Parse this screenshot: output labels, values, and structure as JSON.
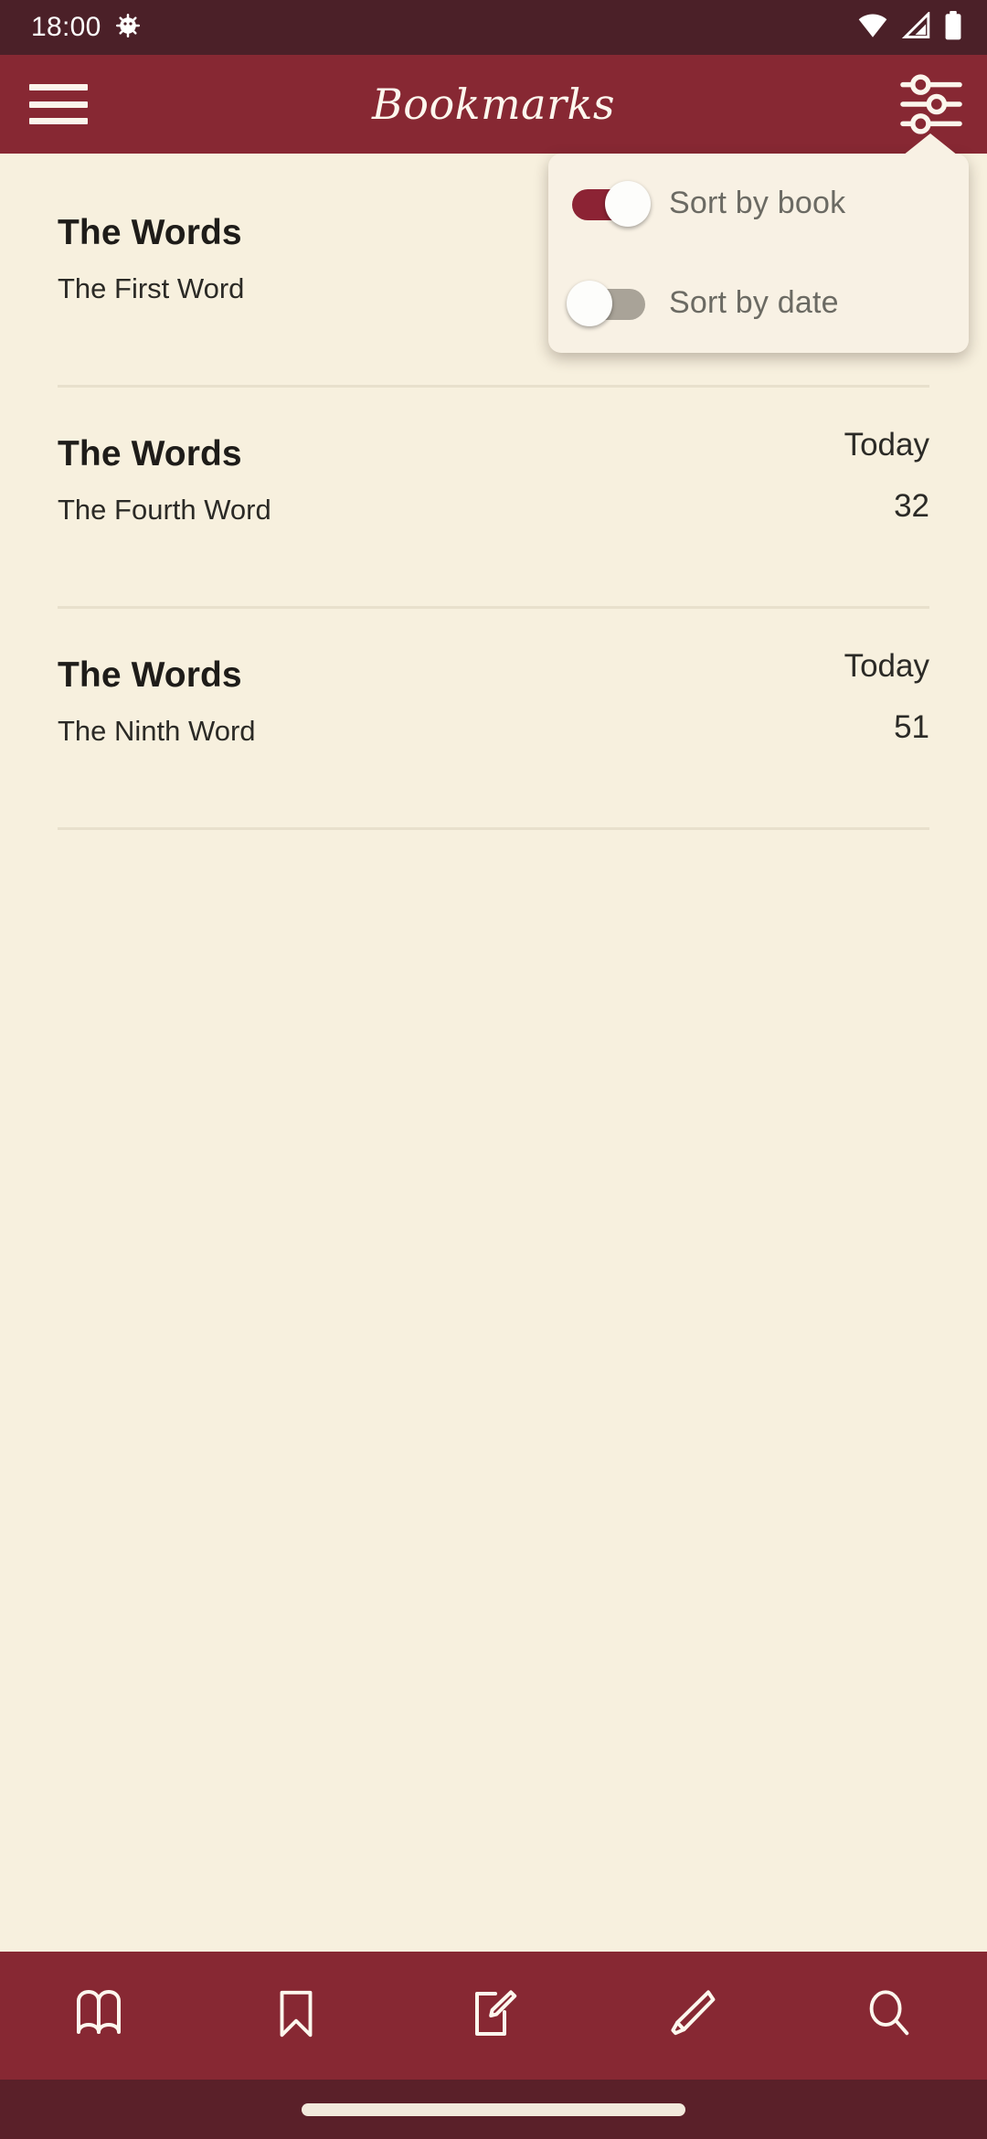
{
  "status_bar": {
    "time": "18:00",
    "left_icons": [
      "bug-icon"
    ],
    "right_icons": [
      "wifi-icon",
      "cellular-signal-icon",
      "battery-icon"
    ],
    "background_color": "#4B2028"
  },
  "app_bar": {
    "title": "Bookmarks",
    "menu_icon": "hamburger-menu-icon",
    "action_icon": "tune-sliders-icon",
    "background_color": "#872833",
    "text_color": "#FDF7EE"
  },
  "sort_menu": {
    "visible": true,
    "background_color": "#F8F1E4",
    "items": [
      {
        "label": "Sort by book",
        "state": "on",
        "toggle_color": "#8C2334"
      },
      {
        "label": "Sort by date",
        "state": "off",
        "toggle_color": "#A9A398"
      }
    ]
  },
  "bookmark_list": {
    "background_color": "#F7F0DE",
    "items": [
      {
        "title": "The Words",
        "subtitle": "The First Word",
        "date": "",
        "count": ""
      },
      {
        "title": "The Words",
        "subtitle": "The Fourth Word",
        "date": "Today",
        "count": "32"
      },
      {
        "title": "The Words",
        "subtitle": "The Ninth Word",
        "date": "Today",
        "count": "51"
      }
    ]
  },
  "bottom_nav": {
    "background_color": "#872833",
    "items": [
      {
        "name": "library-book-icon",
        "label": "Library"
      },
      {
        "name": "bookmark-icon",
        "label": "Bookmarks"
      },
      {
        "name": "note-edit-icon",
        "label": "Notes"
      },
      {
        "name": "highlighter-icon",
        "label": "Highlights"
      },
      {
        "name": "search-icon",
        "label": "Search"
      }
    ],
    "active_index": 1
  },
  "gesture_bar": {
    "background_color": "#5A2029"
  }
}
